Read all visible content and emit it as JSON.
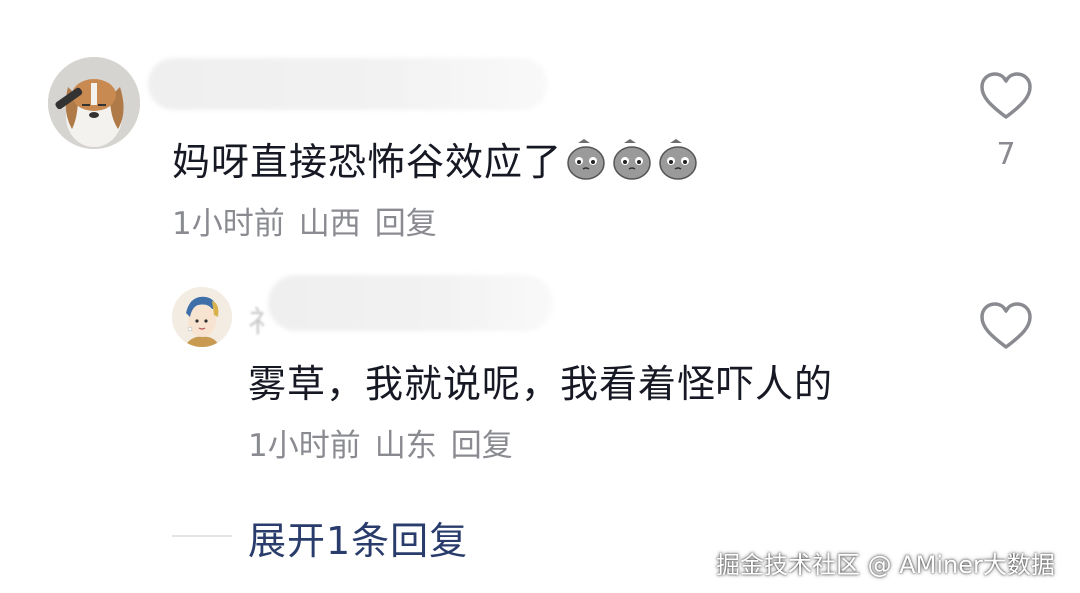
{
  "comments": [
    {
      "text": "妈呀直接恐怖谷效应了",
      "emoji": [
        "sad-potato-emoji",
        "sad-potato-emoji",
        "sad-potato-emoji"
      ],
      "time": "1小时前",
      "location": "山西",
      "reply_label": "回复",
      "like_count": "7",
      "avatar": "beagle-dog-avatar"
    },
    {
      "text": "雾草，我就说呢，我看着怪吓人的",
      "time": "1小时前",
      "location": "山东",
      "reply_label": "回复",
      "avatar": "girl-with-pearl-earring-avatar"
    }
  ],
  "expand_replies_label": "展开1条回复",
  "watermark": "掘金技术社区 @ AMiner大数据",
  "colors": {
    "text": "#161823",
    "meta": "#8a8b91",
    "link": "#2a3c6b",
    "icon": "#8a8b91"
  }
}
